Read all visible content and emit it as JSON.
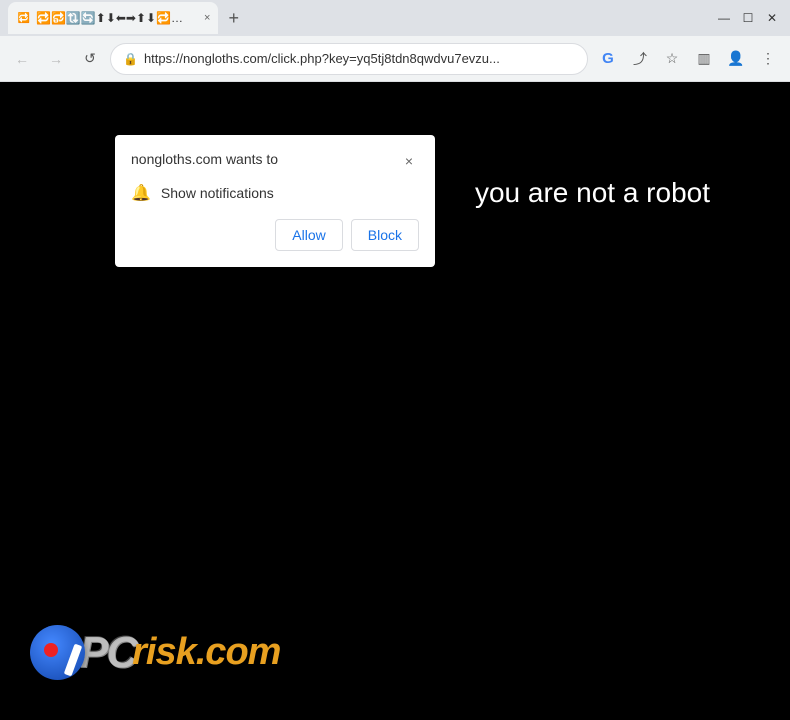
{
  "browser": {
    "title_bar": {
      "tab_label": "🔁🔂🔃🔄⬆⬇⬅➡⬆⬇🔁🔂🔃🔄⬆⬇",
      "tab_close": "×",
      "new_tab": "+",
      "window_minimize": "—",
      "window_maximize": "☐",
      "window_close": "✕"
    },
    "address_bar": {
      "back": "←",
      "forward": "→",
      "refresh": "↺",
      "url": "https://nongloths.com/click.php?key=yq5tj8tdn8qwdvu7evzu...",
      "search_icon": "G",
      "share_icon": "⤴",
      "bookmark_icon": "☆",
      "sidebar_icon": "▥",
      "profile_icon": "👤",
      "menu_icon": "⋮"
    }
  },
  "popup": {
    "title": "nongloths.com wants to",
    "close_label": "×",
    "permission_label": "Show notifications",
    "allow_label": "Allow",
    "block_label": "Block"
  },
  "page": {
    "robot_text": "you are not a robot",
    "logo_pc": "PC",
    "logo_risk": "risk",
    "logo_com": ".com"
  }
}
